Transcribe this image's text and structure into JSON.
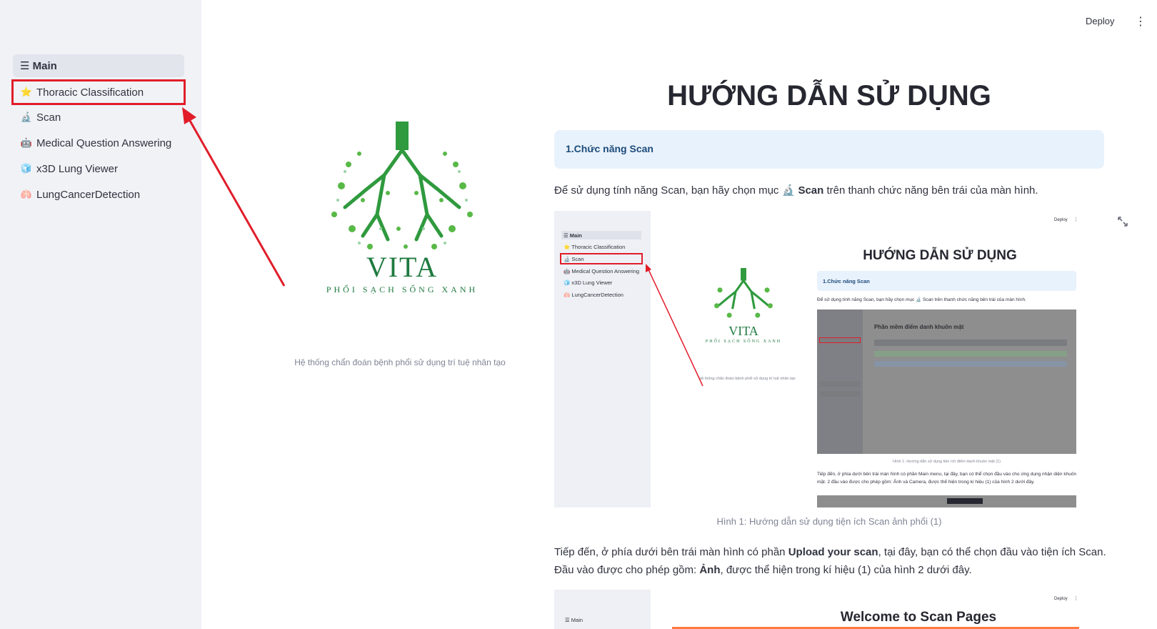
{
  "header": {
    "deploy_label": "Deploy",
    "menu_icon": "kebab-menu-icon"
  },
  "sidebar": {
    "items": [
      {
        "label": "☰ Main",
        "icon": ""
      },
      {
        "label": "Thoracic Classification",
        "icon": "⭐"
      },
      {
        "label": "Scan",
        "icon": "🔬"
      },
      {
        "label": "Medical Question Answering",
        "icon": "🤖"
      },
      {
        "label": "x3D Lung Viewer",
        "icon": "🧊"
      },
      {
        "label": "LungCancerDetection",
        "icon": "🫁"
      }
    ]
  },
  "logo": {
    "title": "VITA",
    "subtitle": "PHỔI SẠCH SỐNG XANH",
    "caption": "Hệ thống chẩn đoán bệnh phổi sử dụng trí tuệ nhân tạo"
  },
  "main": {
    "title": "HƯỚNG DẪN SỬ DỤNG",
    "info_box": "1.Chức năng Scan",
    "para1_a": "Để sử dụng tính năng Scan, bạn hãy chọn mục ",
    "para1_icon": "🔬",
    "para1_bold": "Scan",
    "para1_b": " trên thanh chức năng bên trái của màn hình.",
    "figure1_caption": "Hình 1: Hướng dẫn sử dụng tiện ích Scan ảnh phổi (1)",
    "para2_a": "Tiếp đến, ở phía dưới bên trái màn hình có phần ",
    "para2_bold1": "Upload your scan",
    "para2_b": ", tại đây, bạn có thể chọn đầu vào tiện ích Scan. Đầu vào được cho phép gồm: ",
    "para2_bold2": "Ảnh",
    "para2_c": ", được thể hiện trong kí hiệu (1) của hình 2 dưới đây."
  },
  "figure1": {
    "deploy": "Deploy",
    "sidebar": [
      "☰ Main",
      "⭐ Thoracic Classification",
      "🔬 Scan",
      "🤖 Medical Question Answering",
      "🧊 x3D Lung Viewer",
      "🫁 LungCancerDetection"
    ],
    "title": "HƯỚNG DẪN SỬ DỤNG",
    "info_box": "1.Chức năng Scan",
    "para": "Để sử dụng tính năng Scan, bạn hãy chọn mục 🔬 Scan trên thanh chức năng bên trái của màn hình.",
    "logo_title": "VITA",
    "logo_subtitle": "PHỔI SẠCH SỐNG XANH",
    "logo_caption": "Hệ thống chẩn đoán bệnh phổi sử dụng trí tuệ nhân tạo",
    "inner_title": "Phần mềm điểm danh khuôn mặt",
    "inner_caption": "Hình 1: Hướng dẫn sử dụng tiện ích điểm danh khuôn mặt (1)",
    "para2": "Tiếp đến, ở phía dưới bên trái màn hình có phần Main menu, tại đây, bạn có thể chọn đầu vào cho ứng dụng nhận diện khuôn mặt. 2 đầu vào được cho phép gồm: Ảnh và Camera, được thể hiện trong kí hiệu (1) của hình 2 dưới đây."
  },
  "figure2": {
    "deploy": "Deploy",
    "sidebar_main": "☰ Main",
    "title": "Welcome to Scan Pages"
  },
  "colors": {
    "accent_red": "#e11d2a",
    "sidebar_bg": "#f0f2f6",
    "info_bg": "#e8f2fc",
    "brand_green": "#1f7a3f"
  }
}
